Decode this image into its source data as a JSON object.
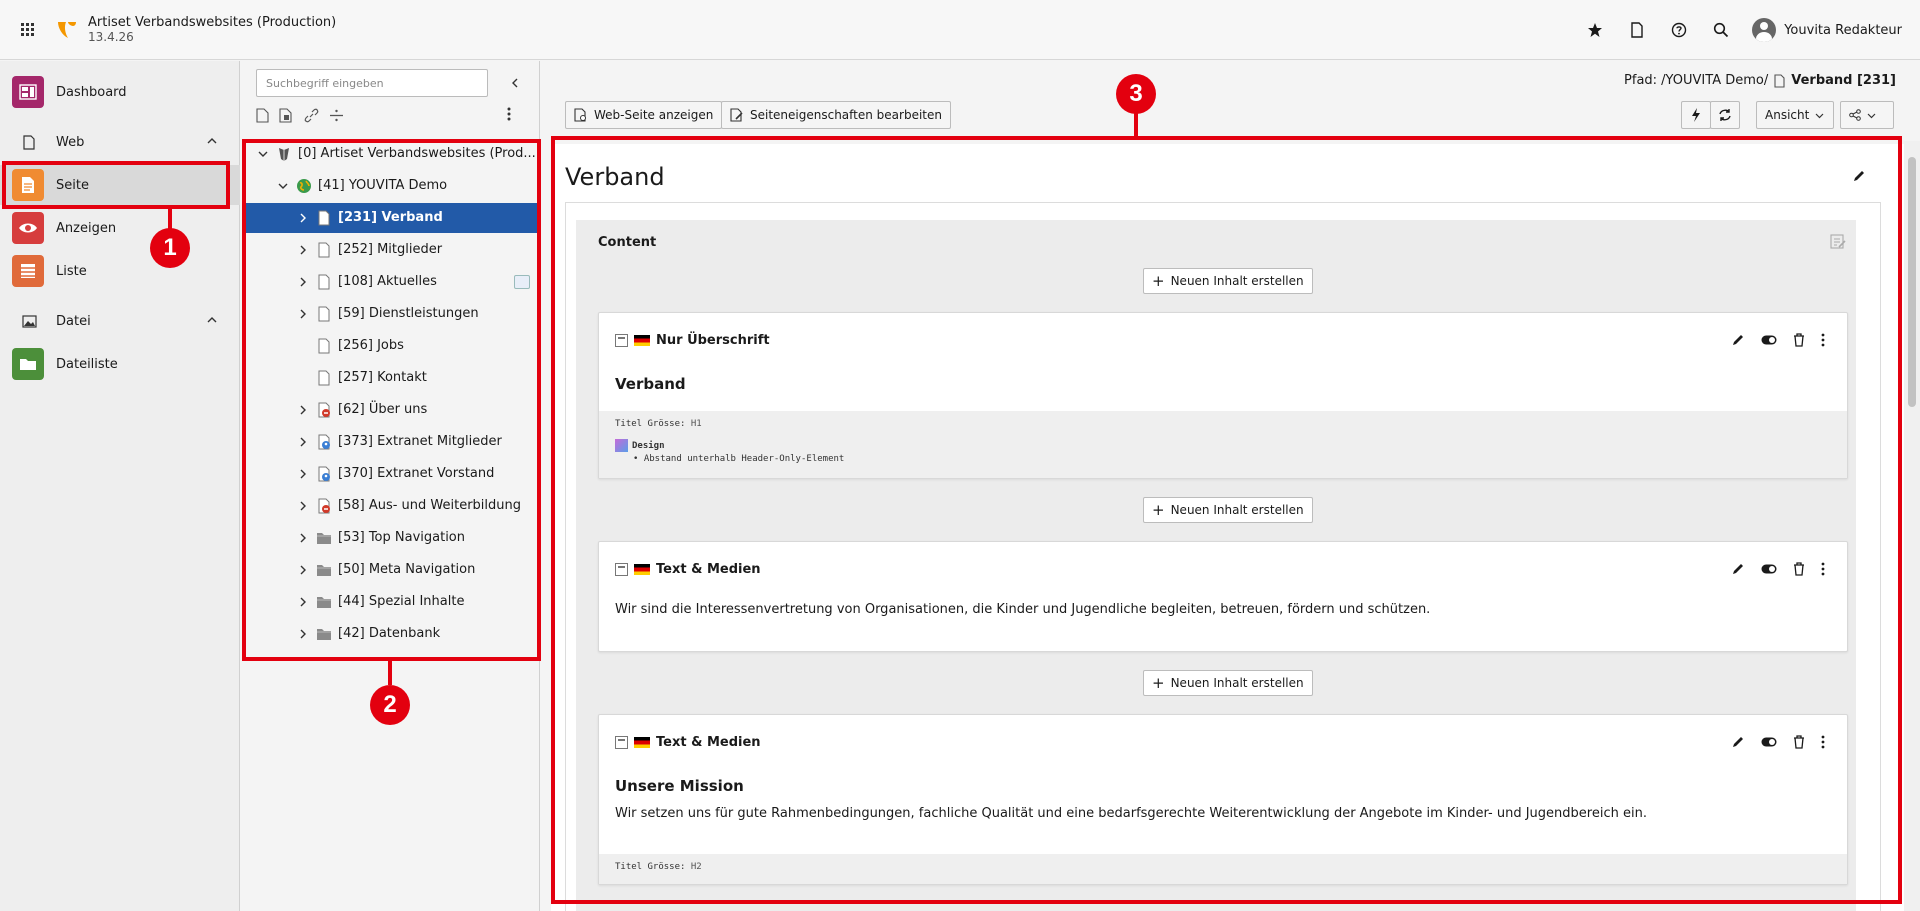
{
  "app": {
    "title": "Artiset Verbandswebsites (Production)",
    "version": "13.4.26",
    "user_name": "Youvita Redakteur"
  },
  "modules": {
    "dashboard": "Dashboard",
    "web_group": "Web",
    "seite": "Seite",
    "anzeigen": "Anzeigen",
    "liste": "Liste",
    "datei_group": "Datei",
    "dateiliste": "Dateiliste"
  },
  "tree": {
    "search_placeholder": "Suchbegriff eingeben",
    "nodes": [
      {
        "label": "[0] Artiset Verbandswebsites (Prod..."
      },
      {
        "label": "[41] YOUVITA Demo"
      },
      {
        "label": "[231] Verband"
      },
      {
        "label": "[252] Mitglieder"
      },
      {
        "label": "[108] Aktuelles"
      },
      {
        "label": "[59] Dienstleistungen"
      },
      {
        "label": "[256] Jobs"
      },
      {
        "label": "[257] Kontakt"
      },
      {
        "label": "[62] Über uns"
      },
      {
        "label": "[373] Extranet Mitglieder"
      },
      {
        "label": "[370] Extranet Vorstand"
      },
      {
        "label": "[58] Aus- und Weiterbildung"
      },
      {
        "label": "[53] Top Navigation"
      },
      {
        "label": "[50] Meta Navigation"
      },
      {
        "label": "[44] Spezial Inhalte"
      },
      {
        "label": "[42] Datenbank"
      }
    ]
  },
  "content": {
    "path_prefix": "Pfad: /YOUVITA Demo/",
    "path_page": "Verband [231]",
    "btn_view": "Web-Seite anzeigen",
    "btn_edit_props": "Seiteneigenschaften bearbeiten",
    "btn_ansicht": "Ansicht",
    "page_title": "Verband",
    "column_title": "Content",
    "new_content": "Neuen Inhalt erstellen",
    "elements": [
      {
        "type": "Nur Überschrift",
        "heading": "Verband",
        "footer_label": "Titel Grösse:",
        "footer_value": "H1",
        "design_label": "Design",
        "design_item": "Abstand unterhalb Header-Only-Element"
      },
      {
        "type": "Text & Medien",
        "text": "Wir sind die Interessenvertretung von Organisationen, die Kinder und Jugendliche begleiten, betreuen, fördern und schützen."
      },
      {
        "type": "Text & Medien",
        "heading": "Unsere Mission",
        "text": "Wir setzen uns für gute Rahmenbedingungen, fachliche Qualität und eine bedarfsgerechte Weiterentwicklung der Angebote im Kinder- und Jugendbereich ein.",
        "footer_label": "Titel Grösse:",
        "footer_value": "H2"
      }
    ]
  },
  "annotations": [
    "1",
    "2",
    "3"
  ],
  "colors": {
    "accent_red": "#e3000f",
    "selected_blue": "#225aa8",
    "typo3_orange": "#f49700"
  }
}
